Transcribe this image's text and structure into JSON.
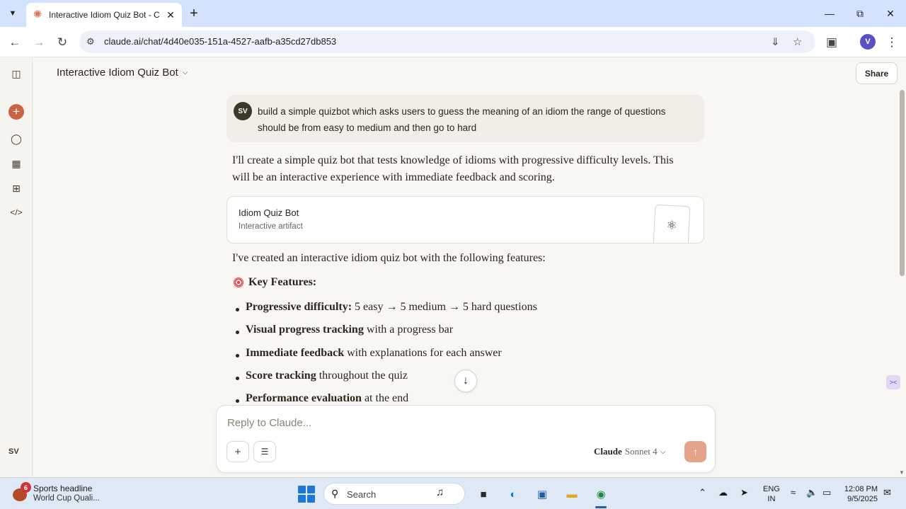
{
  "browser": {
    "tab_title": "Interactive Idiom Quiz Bot - Cla",
    "url": "claude.ai/chat/4d40e035-151a-4527-aafb-a35cd27db853",
    "profile_initial": "V"
  },
  "app": {
    "chat_title": "Interactive Idiom Quiz Bot",
    "share_label": "Share",
    "user_initials": "SV",
    "accent_color": "#c96442"
  },
  "conversation": {
    "user_avatar": "SV",
    "user_message": "build a simple quizbot which asks users to guess the meaning of an idiom the range of questions should be from easy to medium and then go to hard",
    "response_intro": "I'll create a simple quiz bot that tests knowledge of idioms with progressive difficulty levels. This will be an interactive experience with immediate feedback and scoring.",
    "artifact": {
      "title": "Idiom Quiz Bot",
      "subtitle": "Interactive artifact"
    },
    "response_body": "I've created an interactive idiom quiz bot with the following features:",
    "features_heading": "Key Features:",
    "features": [
      {
        "bold": "Progressive difficulty:",
        "rest": " 5 easy → 5 medium → 5 hard questions"
      },
      {
        "bold": "Visual progress tracking",
        "rest": " with a progress bar"
      },
      {
        "bold": "Immediate feedback",
        "rest": " with explanations for each answer"
      },
      {
        "bold": "Score tracking",
        "rest": " throughout the quiz"
      },
      {
        "bold": "Performance evaluation",
        "rest": " at the end"
      }
    ]
  },
  "composer": {
    "placeholder": "Reply to Claude...",
    "model_brand": "Claude",
    "model_name": "Sonnet 4"
  },
  "taskbar": {
    "news_badge": "6",
    "news_title": "Sports headline",
    "news_subtitle": "World Cup Quali...",
    "search_label": "Search",
    "lang_line1": "ENG",
    "lang_line2": "IN",
    "time": "12:08 PM",
    "date": "9/5/2025"
  },
  "icons": {
    "rail": [
      "sidebar-toggle-icon",
      "new-chat-icon",
      "chats-icon",
      "projects-icon",
      "artifacts-icon",
      "code-icon"
    ],
    "artifact": "atom-icon"
  }
}
